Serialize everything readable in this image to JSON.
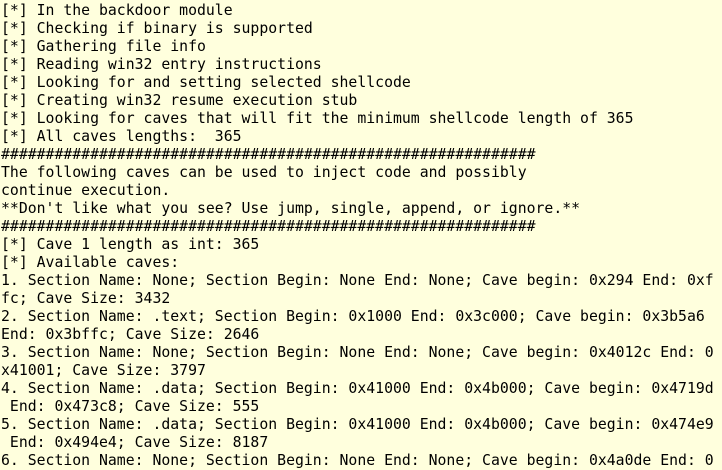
{
  "terminal": {
    "lines": [
      "[*] In the backdoor module",
      "[*] Checking if binary is supported",
      "[*] Gathering file info",
      "[*] Reading win32 entry instructions",
      "[*] Looking for and setting selected shellcode",
      "[*] Creating win32 resume execution stub",
      "[*] Looking for caves that will fit the minimum shellcode length of 365",
      "[*] All caves lengths:  365",
      "############################################################",
      "The following caves can be used to inject code and possibly",
      "continue execution.",
      "**Don't like what you see? Use jump, single, append, or ignore.**",
      "############################################################",
      "[*] Cave 1 length as int: 365",
      "[*] Available caves:",
      "1. Section Name: None; Section Begin: None End: None; Cave begin: 0x294 End: 0xf",
      "fc; Cave Size: 3432",
      "2. Section Name: .text; Section Begin: 0x1000 End: 0x3c000; Cave begin: 0x3b5a6",
      "End: 0x3bffc; Cave Size: 2646",
      "3. Section Name: None; Section Begin: None End: None; Cave begin: 0x4012c End: 0",
      "x41001; Cave Size: 3797",
      "4. Section Name: .data; Section Begin: 0x41000 End: 0x4b000; Cave begin: 0x4719d",
      " End: 0x473c8; Cave Size: 555",
      "5. Section Name: .data; Section Begin: 0x41000 End: 0x4b000; Cave begin: 0x474e9",
      " End: 0x494e4; Cave Size: 8187",
      "6. Section Name: None; Section Begin: None End: None; Cave begin: 0x4a0de End: 0"
    ]
  },
  "colors": {
    "background": "#ffffdd",
    "text": "#000000"
  }
}
